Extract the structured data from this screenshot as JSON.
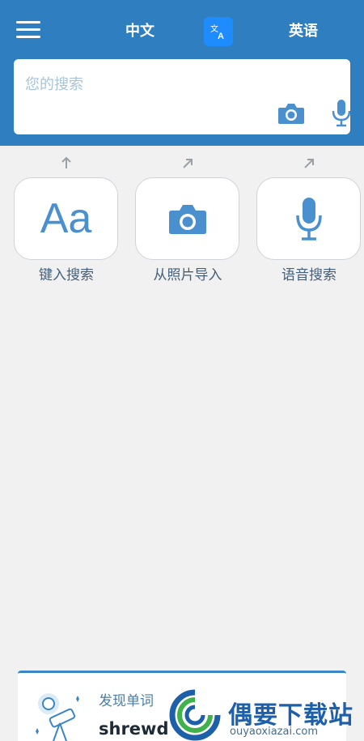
{
  "header": {
    "source_language": "中文",
    "target_language": "英语",
    "swap_icon": "translate-icon",
    "menu_icon": "hamburger-menu-icon"
  },
  "search": {
    "placeholder": "您的搜索",
    "camera_icon": "camera-icon",
    "mic_icon": "microphone-icon"
  },
  "actions": [
    {
      "label": "键入搜索",
      "icon_text": "Aa",
      "icon": "text-input-icon"
    },
    {
      "label": "从照片导入",
      "icon": "camera-icon"
    },
    {
      "label": "语音搜索",
      "icon": "microphone-icon"
    }
  ],
  "discover": {
    "title": "发现单词",
    "word": "shrewd",
    "illustration": "telescope-illustration"
  },
  "watermark": {
    "name": "偶要下载站",
    "url": "ouyaoxiazai.com"
  },
  "colors": {
    "header_bg": "#2f7fc0",
    "accent": "#4a90cf",
    "swap_button": "#1e8bff",
    "page_bg": "#f1f1f2"
  }
}
